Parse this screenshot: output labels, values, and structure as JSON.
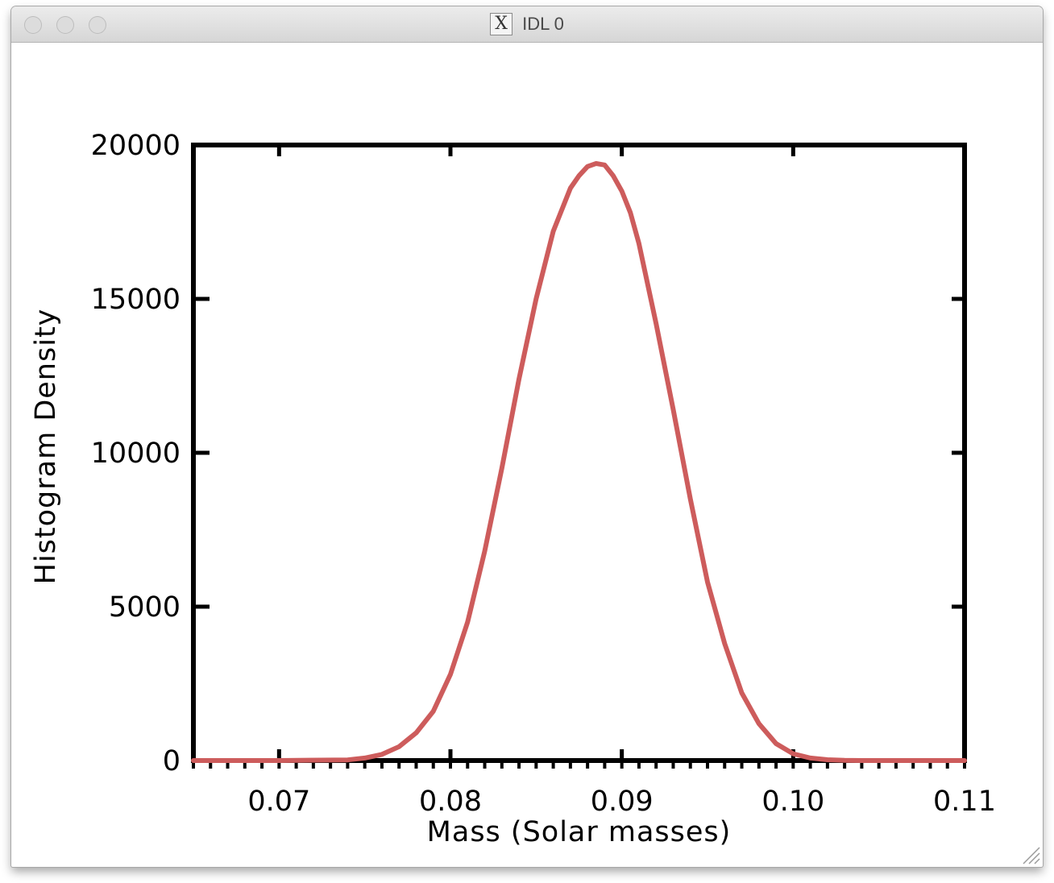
{
  "window": {
    "title": "IDL 0",
    "app_icon": "x11-icon",
    "controls": [
      "close",
      "minimize",
      "zoom"
    ]
  },
  "colors": {
    "series": "#cd5c5c",
    "axes": "#000000",
    "titlebar": "#e3e3e3"
  },
  "chart_data": {
    "type": "line",
    "title": "",
    "xlabel": "Mass (Solar masses)",
    "ylabel": "Histogram Density",
    "xlim": [
      0.065,
      0.11
    ],
    "ylim": [
      0,
      20000
    ],
    "xticks": [
      {
        "value": 0.07,
        "label": "0.07"
      },
      {
        "value": 0.08,
        "label": "0.08"
      },
      {
        "value": 0.09,
        "label": "0.09"
      },
      {
        "value": 0.1,
        "label": "0.10"
      },
      {
        "value": 0.11,
        "label": "0.11"
      }
    ],
    "yticks": [
      {
        "value": 0,
        "label": "0"
      },
      {
        "value": 5000,
        "label": "5000"
      },
      {
        "value": 10000,
        "label": "10000"
      },
      {
        "value": 15000,
        "label": "15000"
      },
      {
        "value": 20000,
        "label": "20000"
      }
    ],
    "grid": false,
    "legend": "none",
    "series": [
      {
        "x": [
          0.065,
          0.07,
          0.074,
          0.075,
          0.076,
          0.077,
          0.078,
          0.079,
          0.08,
          0.081,
          0.082,
          0.083,
          0.084,
          0.085,
          0.086,
          0.087,
          0.0875,
          0.088,
          0.0885,
          0.089,
          0.0895,
          0.09,
          0.0905,
          0.091,
          0.092,
          0.093,
          0.094,
          0.095,
          0.096,
          0.097,
          0.098,
          0.099,
          0.1,
          0.101,
          0.102,
          0.103,
          0.104,
          0.11
        ],
        "y": [
          0,
          0,
          20,
          80,
          200,
          450,
          900,
          1600,
          2800,
          4500,
          6800,
          9500,
          12400,
          15000,
          17200,
          18600,
          19000,
          19300,
          19400,
          19350,
          19000,
          18500,
          17800,
          16800,
          14200,
          11400,
          8500,
          5800,
          3800,
          2200,
          1200,
          550,
          220,
          80,
          25,
          5,
          0,
          0
        ]
      }
    ]
  }
}
